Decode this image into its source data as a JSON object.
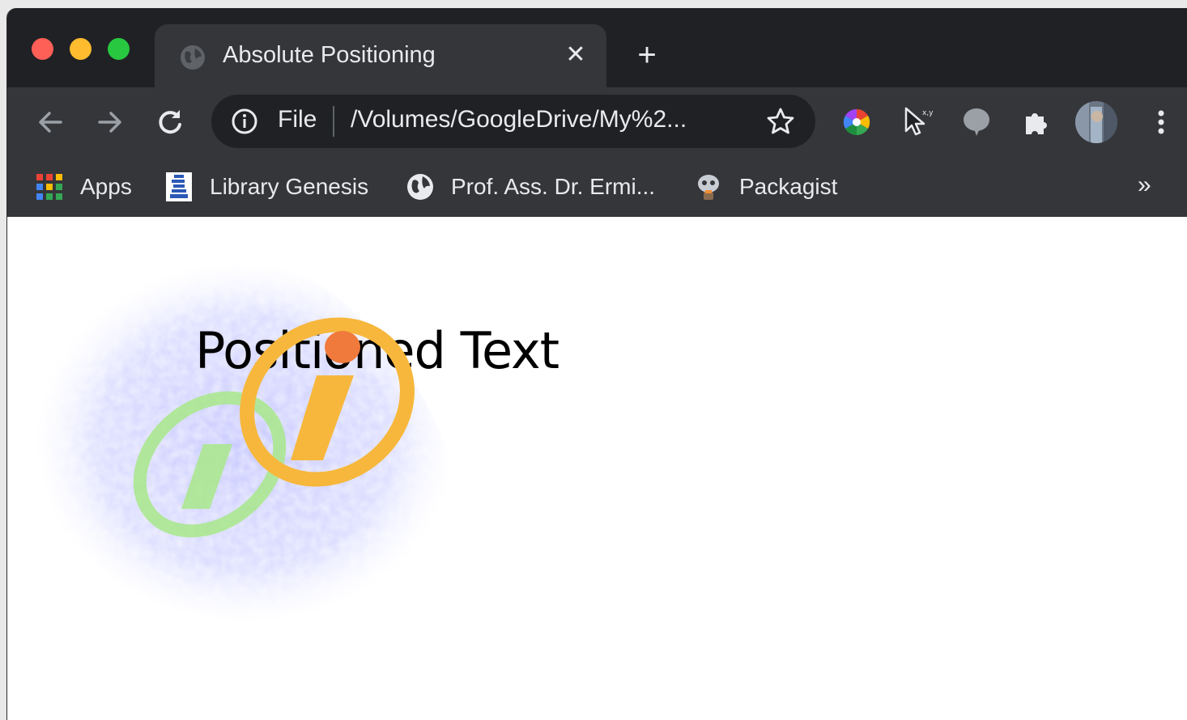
{
  "window": {
    "tab_title": "Absolute Positioning",
    "tab_close": "✕",
    "new_tab": "+"
  },
  "toolbar": {
    "scheme": "File",
    "url": "/Volumes/GoogleDrive/My%2..."
  },
  "bookmarks": {
    "items": [
      {
        "label": "Apps",
        "icon": "apps-grid-icon"
      },
      {
        "label": "Library Genesis",
        "icon": "library-genesis-icon"
      },
      {
        "label": "Prof. Ass. Dr. Ermi...",
        "icon": "globe-icon"
      },
      {
        "label": "Packagist",
        "icon": "packagist-icon"
      }
    ],
    "more": "»"
  },
  "page": {
    "positioned_text": "Positioned Text"
  },
  "colors": {
    "logo_orange": "#f7b73c",
    "logo_dot": "#ef7a3c",
    "logo_green": "#a8e88a",
    "logo_blue": "#c7c9ff"
  }
}
